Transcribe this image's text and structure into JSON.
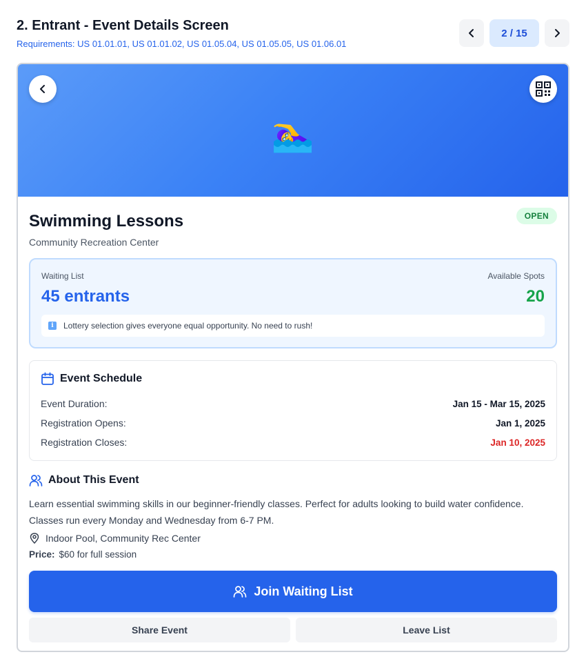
{
  "header": {
    "title": "2. Entrant - Event Details Screen",
    "requirements": "Requirements: US 01.01.01, US 01.01.02, US 01.05.04, US 01.05.05, US 01.06.01",
    "pager": {
      "count": "2 / 15",
      "prev_icon": "chevron-left-icon",
      "next_icon": "chevron-right-icon"
    }
  },
  "hero": {
    "emoji": "🏊‍♀️",
    "back_icon": "chevron-left-icon",
    "qr_icon": "qr-code-icon",
    "gradient": [
      "#5b9bf8",
      "#2563eb"
    ]
  },
  "event": {
    "title": "Swimming Lessons",
    "venue": "Community Recreation Center",
    "status": "OPEN"
  },
  "waiting": {
    "label": "Waiting List",
    "entrants": "45 entrants",
    "spots_label": "Available Spots",
    "spots": "20",
    "note": "Lottery selection gives everyone equal opportunity. No need to rush!"
  },
  "schedule": {
    "heading": "Event Schedule",
    "rows": [
      {
        "label": "Event Duration:",
        "value": "Jan 15 - Mar 15, 2025"
      },
      {
        "label": "Registration Opens:",
        "value": "Jan 1, 2025"
      },
      {
        "label": "Registration Closes:",
        "value": "Jan 10, 2025"
      }
    ]
  },
  "about": {
    "heading": "About This Event",
    "description": "Learn essential swimming skills in our beginner-friendly classes. Perfect for adults looking to build water confidence. Classes run every Monday and Wednesday from 6-7 PM.",
    "location": "Indoor Pool, Community Rec Center",
    "price_label": "Price:",
    "price": "$60 for full session"
  },
  "actions": {
    "join": "Join Waiting List",
    "share": "Share Event",
    "leave": "Leave List"
  },
  "colors": {
    "primary": "#2563eb",
    "success": "#16a34a",
    "danger": "#dc2626"
  }
}
